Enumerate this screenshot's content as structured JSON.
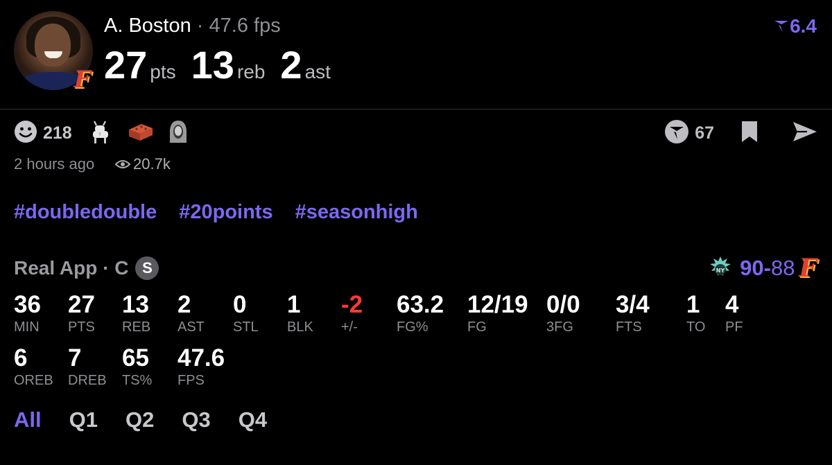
{
  "header": {
    "player_name": "A. Boston",
    "separator": " · ",
    "fps_text": "47.6 fps",
    "points": "27",
    "points_unit": "pts",
    "rebounds": "13",
    "rebounds_unit": "reb",
    "assists": "2",
    "assists_unit": "ast",
    "rating": "6.4",
    "rating_icon": "rating-arrow-icon",
    "avatar_icon": "player-avatar",
    "team_logo": "F"
  },
  "reactions": {
    "smile_count": "218",
    "icons": [
      "smile-icon",
      "goat-icon",
      "brick-icon",
      "ghost-icon"
    ]
  },
  "actions": {
    "vote_count": "67",
    "icons": [
      "vote-icon",
      "bookmark-icon",
      "share-icon"
    ]
  },
  "meta": {
    "time_ago": "2 hours ago",
    "views": "20.7k"
  },
  "tags": [
    "#doubledouble",
    "#20points",
    "#seasonhigh"
  ],
  "source": {
    "label": "Real App · C",
    "badge": "S"
  },
  "score": {
    "home": "90",
    "dash": "-",
    "away": "88",
    "home_logo": "liberty-logo",
    "away_logo": "fever-logo"
  },
  "stats": [
    {
      "value": "36",
      "label": "MIN"
    },
    {
      "value": "27",
      "label": "PTS"
    },
    {
      "value": "13",
      "label": "REB"
    },
    {
      "value": "2",
      "label": "AST"
    },
    {
      "value": "0",
      "label": "STL"
    },
    {
      "value": "1",
      "label": "BLK"
    },
    {
      "value": "-2",
      "label": "+/-"
    },
    {
      "value": "63.2",
      "label": "FG%"
    },
    {
      "value": "12/19",
      "label": "FG"
    },
    {
      "value": "0/0",
      "label": "3FG"
    },
    {
      "value": "3/4",
      "label": "FTS"
    },
    {
      "value": "1",
      "label": "TO"
    },
    {
      "value": "4",
      "label": "PF"
    },
    {
      "value": "6",
      "label": "OREB"
    },
    {
      "value": "7",
      "label": "DREB"
    },
    {
      "value": "65",
      "label": "TS%"
    },
    {
      "value": "47.6",
      "label": "FPS"
    }
  ],
  "quarters": [
    "All",
    "Q1",
    "Q2",
    "Q3",
    "Q4"
  ],
  "colors": {
    "accent": "#7b68ee",
    "negative": "#ff3b30",
    "muted": "#8e8e93"
  }
}
